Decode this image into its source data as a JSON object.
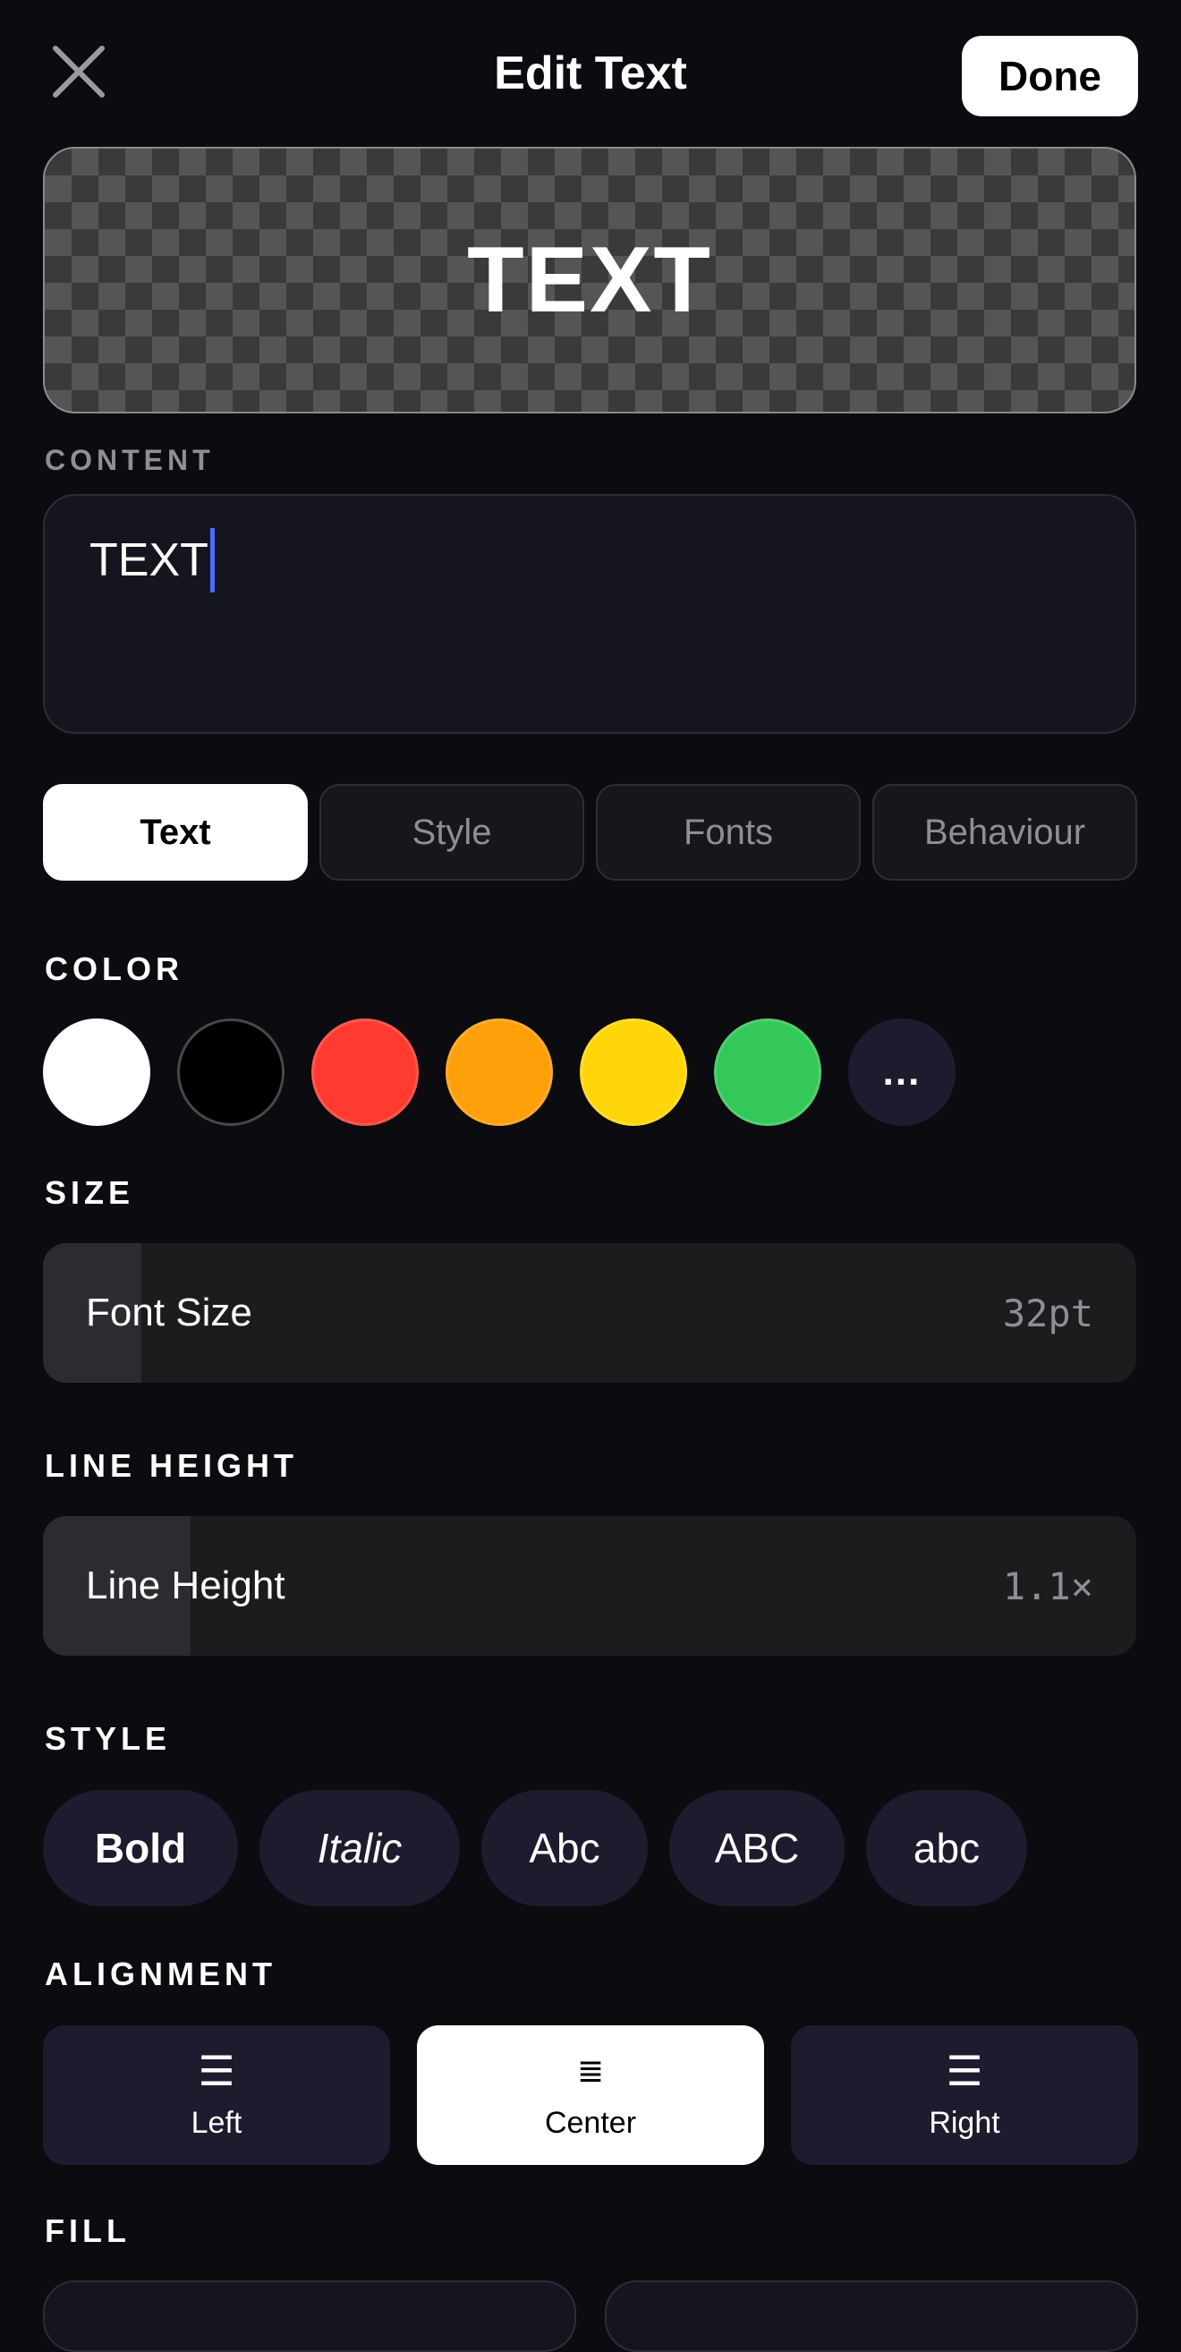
{
  "header": {
    "title": "Edit Text",
    "done_label": "Done"
  },
  "preview": {
    "text": "TEXT"
  },
  "content": {
    "label": "CONTENT",
    "value": "TEXT"
  },
  "tabs": [
    {
      "label": "Text",
      "active": true
    },
    {
      "label": "Style",
      "active": false
    },
    {
      "label": "Fonts",
      "active": false
    },
    {
      "label": "Behaviour",
      "active": false
    }
  ],
  "color": {
    "label": "COLOR",
    "swatches": [
      "#ffffff",
      "#000000",
      "#ff3b30",
      "#ff9f0a",
      "#ffd60a",
      "#34c759"
    ],
    "more_label": "...",
    "selected": "#ffffff"
  },
  "size": {
    "label": "SIZE",
    "slider_label": "Font Size",
    "value_text": "32pt",
    "level": 0.09
  },
  "line_height": {
    "label": "LINE HEIGHT",
    "slider_label": "Line Height",
    "value_text": "1.1×",
    "level": 0.135
  },
  "style": {
    "label": "STYLE",
    "options": [
      "Bold",
      "Italic",
      "Abc",
      "ABC",
      "abc"
    ]
  },
  "alignment": {
    "label": "ALIGNMENT",
    "options": [
      {
        "label": "Left",
        "icon": "align-left-icon",
        "active": false
      },
      {
        "label": "Center",
        "icon": "align-center-icon",
        "active": true
      },
      {
        "label": "Right",
        "icon": "align-right-icon",
        "active": false
      }
    ]
  },
  "fill": {
    "label": "FILL"
  },
  "colors": {
    "background": "#0b0b10",
    "accent_caret": "#4a6cff",
    "control_bg": "#1c1c2e"
  }
}
